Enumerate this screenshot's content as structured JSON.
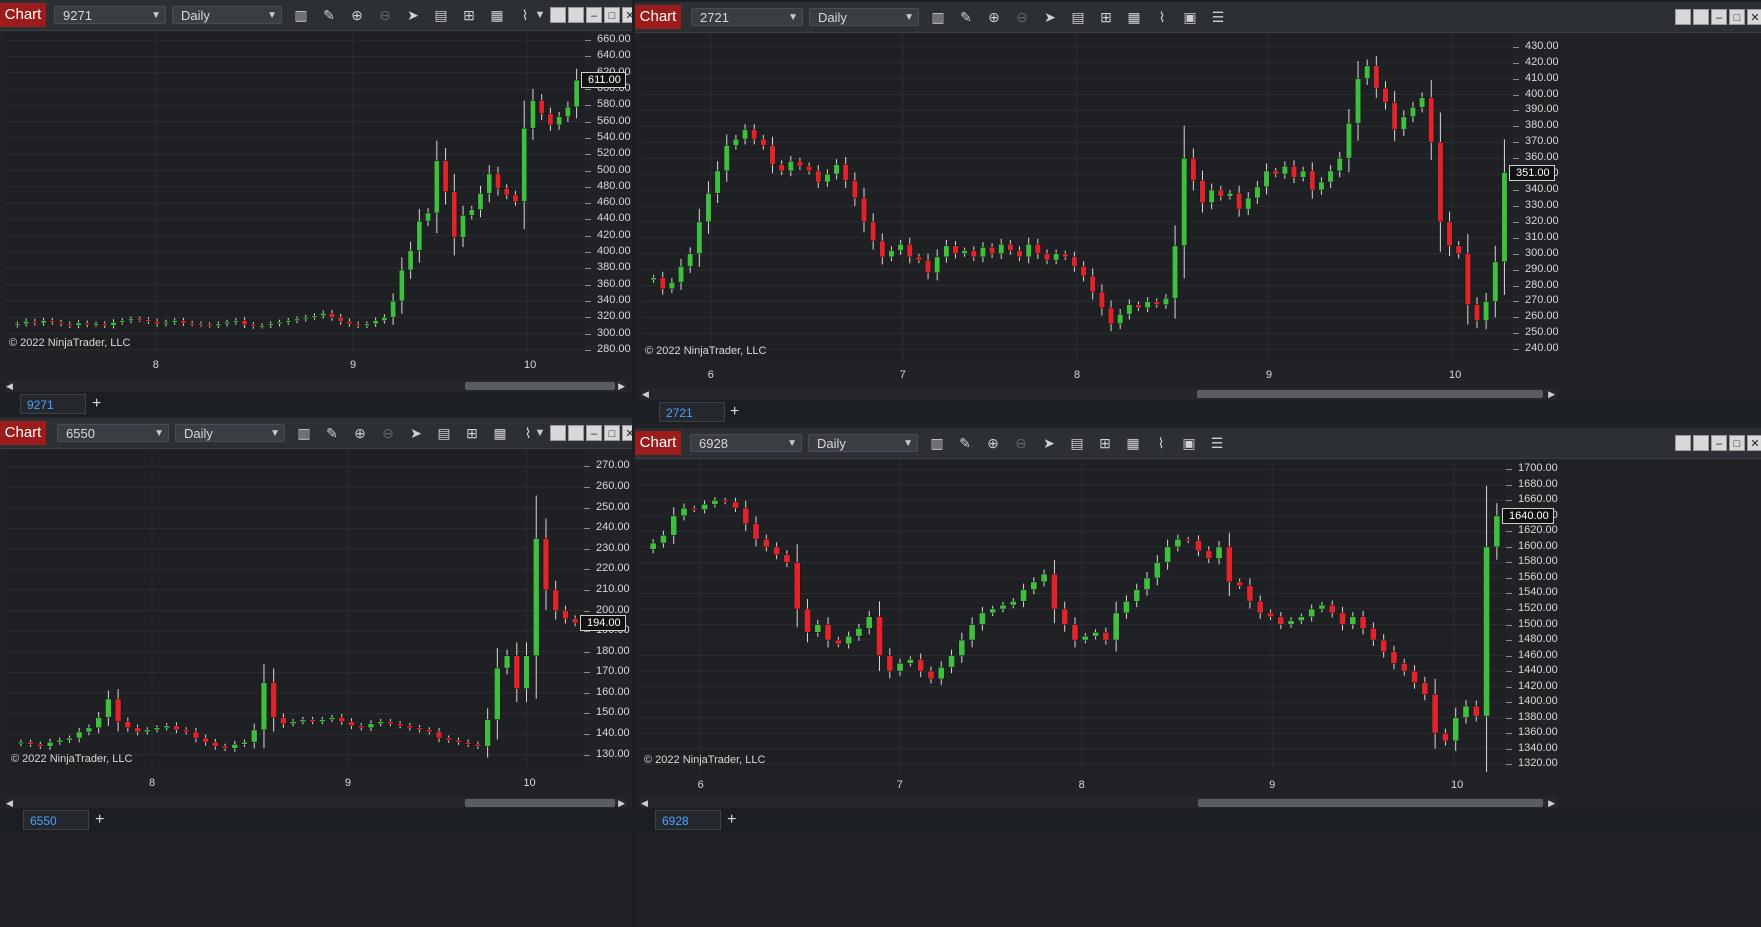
{
  "windows": [
    {
      "id": "w1",
      "chart_label": "Chart",
      "instrument": "9271",
      "period": "Daily",
      "price_tag": "611.00",
      "copyright": "© 2022 NinjaTrader, LLC",
      "tab_label": "9271",
      "tab_add": "+",
      "y_ticks": [
        "660.00",
        "640.00",
        "620.00",
        "600.00",
        "580.00",
        "560.00",
        "540.00",
        "520.00",
        "500.00",
        "480.00",
        "460.00",
        "440.00",
        "420.00",
        "400.00",
        "380.00",
        "360.00",
        "340.00",
        "320.00",
        "300.00",
        "280.00"
      ],
      "x_ticks": [
        "8",
        "9",
        "10"
      ]
    },
    {
      "id": "w2",
      "chart_label": "Chart",
      "instrument": "2721",
      "period": "Daily",
      "price_tag": "351.00",
      "copyright": "© 2022 NinjaTrader, LLC",
      "tab_label": "2721",
      "tab_add": "+",
      "y_ticks": [
        "430.00",
        "420.00",
        "410.00",
        "400.00",
        "390.00",
        "380.00",
        "370.00",
        "360.00",
        "350.00",
        "340.00",
        "330.00",
        "320.00",
        "310.00",
        "300.00",
        "290.00",
        "280.00",
        "270.00",
        "260.00",
        "250.00",
        "240.00"
      ],
      "x_ticks": [
        "6",
        "7",
        "8",
        "9",
        "10"
      ]
    },
    {
      "id": "w3",
      "chart_label": "Chart",
      "instrument": "6550",
      "period": "Daily",
      "price_tag": "194.00",
      "copyright": "© 2022 NinjaTrader, LLC",
      "tab_label": "6550",
      "tab_add": "+",
      "y_ticks": [
        "270.00",
        "260.00",
        "250.00",
        "240.00",
        "230.00",
        "220.00",
        "210.00",
        "200.00",
        "190.00",
        "180.00",
        "170.00",
        "160.00",
        "150.00",
        "140.00",
        "130.00"
      ],
      "x_ticks": [
        "8",
        "9",
        "10"
      ]
    },
    {
      "id": "w4",
      "chart_label": "Chart",
      "instrument": "6928",
      "period": "Daily",
      "price_tag": "1640.00",
      "copyright": "© 2022 NinjaTrader, LLC",
      "tab_label": "6928",
      "tab_add": "+",
      "y_ticks": [
        "1700.00",
        "1680.00",
        "1660.00",
        "1640.00",
        "1620.00",
        "1600.00",
        "1580.00",
        "1560.00",
        "1540.00",
        "1520.00",
        "1500.00",
        "1480.00",
        "1460.00",
        "1440.00",
        "1420.00",
        "1400.00",
        "1380.00",
        "1360.00",
        "1340.00",
        "1320.00"
      ],
      "x_ticks": [
        "6",
        "7",
        "8",
        "9",
        "10"
      ]
    }
  ],
  "toolbar_icons": [
    "bar-type-icon",
    "draw-pencil-icon",
    "zoom-in-icon",
    "zoom-out-icon",
    "pointer-icon",
    "properties-icon",
    "templates-icon",
    "indicators-icon",
    "strategies-icon",
    "chart-trader-icon",
    "data-box-icon"
  ],
  "colors": {
    "up": "#3fbf3f",
    "down": "#e0242b",
    "wick": "#d8d8d8",
    "bg": "#1f2023",
    "label": "#9c1c1c"
  },
  "chart_data": [
    {
      "type": "candlestick",
      "instrument": "9271",
      "ylim": [
        275,
        670
      ],
      "last": 611,
      "closes": [
        312,
        315,
        313,
        316,
        314,
        312,
        310,
        313,
        311,
        312,
        310,
        314,
        316,
        318,
        317,
        315,
        312,
        314,
        316,
        313,
        312,
        311,
        310,
        312,
        314,
        316,
        311,
        309,
        310,
        312,
        314,
        316,
        318,
        320,
        322,
        325,
        320,
        315,
        312,
        310,
        312,
        316,
        320,
        340,
        378,
        402,
        438,
        448,
        512,
        474,
        418,
        445,
        452,
        472,
        496,
        478,
        470,
        462,
        552,
        586,
        570,
        556,
        566,
        578,
        611
      ]
    },
    {
      "type": "candlestick",
      "instrument": "2721",
      "ylim": [
        232,
        438
      ],
      "last": 351,
      "closes": [
        285,
        278,
        282,
        292,
        300,
        320,
        338,
        352,
        368,
        372,
        378,
        372,
        368,
        356,
        352,
        358,
        355,
        352,
        345,
        350,
        356,
        346,
        335,
        320,
        308,
        298,
        302,
        306,
        298,
        296,
        288,
        298,
        305,
        300,
        302,
        298,
        304,
        300,
        306,
        302,
        298,
        306,
        300,
        296,
        300,
        298,
        292,
        286,
        276,
        266,
        256,
        262,
        268,
        266,
        270,
        268,
        272,
        305,
        360,
        346,
        332,
        340,
        336,
        338,
        328,
        335,
        342,
        352,
        350,
        355,
        348,
        352,
        340,
        345,
        352,
        360,
        382,
        410,
        418,
        404,
        395,
        378,
        386,
        392,
        398,
        370,
        320,
        305,
        300,
        268,
        258,
        270,
        295,
        351
      ]
    },
    {
      "type": "candlestick",
      "instrument": "6550",
      "ylim": [
        122,
        278
      ],
      "last": 194,
      "closes": [
        136,
        135,
        134,
        136,
        137,
        138,
        141,
        143,
        148,
        157,
        146,
        143,
        141,
        142,
        143,
        144,
        142,
        141,
        138,
        136,
        134,
        133,
        135,
        136,
        142,
        165,
        148,
        145,
        146,
        147,
        146,
        147,
        148,
        146,
        144,
        143,
        145,
        146,
        145,
        144,
        143,
        142,
        141,
        138,
        137,
        136,
        135,
        134,
        147,
        172,
        178,
        162,
        178,
        235,
        210,
        200,
        196,
        194
      ]
    },
    {
      "type": "candlestick",
      "instrument": "6928",
      "ylim": [
        1310,
        1712
      ],
      "last": 1640,
      "closes": [
        1605,
        1615,
        1640,
        1650,
        1648,
        1655,
        1660,
        1658,
        1650,
        1630,
        1610,
        1600,
        1590,
        1580,
        1520,
        1490,
        1500,
        1480,
        1475,
        1485,
        1495,
        1510,
        1460,
        1440,
        1450,
        1455,
        1440,
        1430,
        1445,
        1460,
        1480,
        1500,
        1515,
        1520,
        1525,
        1530,
        1545,
        1555,
        1565,
        1520,
        1500,
        1480,
        1485,
        1490,
        1480,
        1515,
        1530,
        1545,
        1560,
        1580,
        1600,
        1610,
        1608,
        1595,
        1585,
        1600,
        1555,
        1550,
        1530,
        1515,
        1510,
        1500,
        1505,
        1510,
        1520,
        1525,
        1515,
        1500,
        1510,
        1495,
        1480,
        1465,
        1450,
        1440,
        1425,
        1410,
        1360,
        1350,
        1380,
        1395,
        1382,
        1600,
        1640
      ]
    }
  ]
}
